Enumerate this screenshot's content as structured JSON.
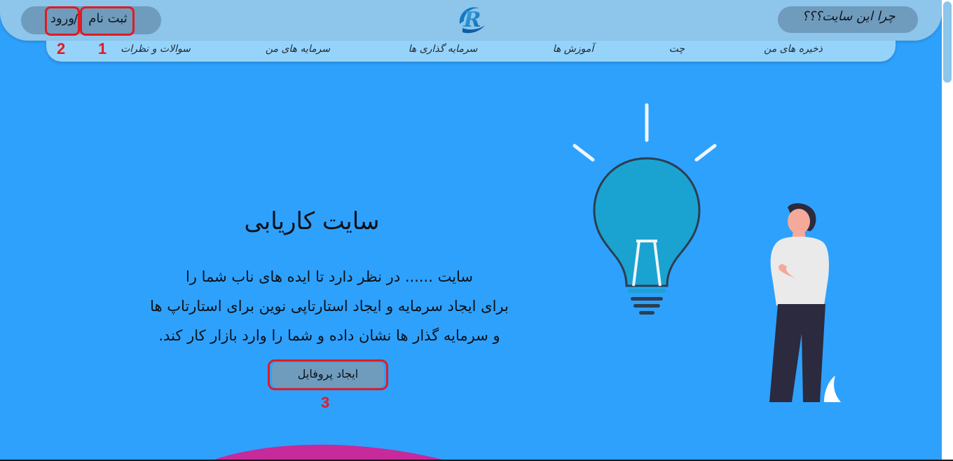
{
  "header": {
    "why_label": "چرا این سایت؟؟؟",
    "signup_label": "ثبت نام",
    "separator": "/",
    "login_label": "ورود",
    "logo_letter": "R"
  },
  "nav": {
    "items": [
      {
        "label": "ذخیره های من"
      },
      {
        "label": "چت"
      },
      {
        "label": "آموزش ها"
      },
      {
        "label": "سرمایه گذاری ها"
      },
      {
        "label": "سرمایه های من"
      },
      {
        "label": "سوالات و نظرات"
      }
    ]
  },
  "hero": {
    "title": "سایت کاریابی",
    "lines": [
      "سایت ...... در نظر دارد تا ایده های ناب شما را",
      "برای ایجاد سرمایه و ایجاد استارتاپی نوین برای استارتاپ ها",
      "و سرمایه گذار ها نشان داده و شما را وارد بازار کار کند."
    ],
    "cta_label": "ایجاد پروفایل"
  },
  "annotations": {
    "n1": "1",
    "n2": "2",
    "n3": "3",
    "color": "#e11b22"
  },
  "colors": {
    "background": "#2ea1fd",
    "header": "#8ec5ea",
    "nav": "#96d3fa",
    "pill": "#6f9bbd"
  }
}
